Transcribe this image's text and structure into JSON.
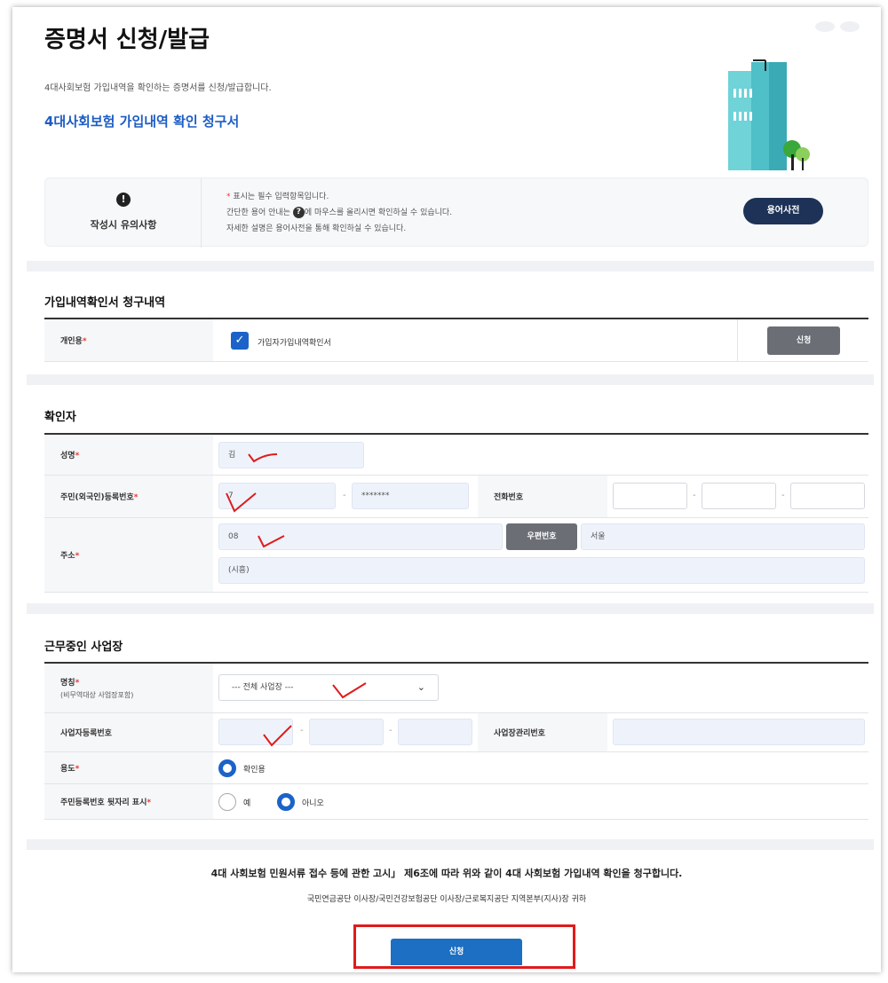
{
  "header": {
    "title": "증명서 신청/발급",
    "description": "4대사회보험 가입내역을 확인하는 증명서를 신청/발급합니다.",
    "doc_title": "4대사회보험 가입내역 확인 청구서"
  },
  "notice": {
    "title": "작성시 유의사항",
    "alert_glyph": "!",
    "line1_star": "*",
    "line1": "표시는 필수 입력항목입니다.",
    "line2_before": "간단한 용어 안내는",
    "line2_icon": "?",
    "line2_after": "에 마우스를 올리시면 확인하실 수 있습니다.",
    "line3": "자세한 설명은 용어사전을 통해 확인하실 수 있습니다.",
    "dict_button": "용어사전"
  },
  "request_section": {
    "title": "가입내역확인서 청구내역",
    "personal_label": "개인용",
    "required_mark": "*",
    "checkbox_glyph": "✓",
    "checkbox_label": "가입자가입내역확인서",
    "apply_button": "신청"
  },
  "verifier_section": {
    "title": "확인자",
    "name_label": "성명",
    "name_value": "김",
    "rrn_label": "주민(외국인)등록번호",
    "rrn_front": "7",
    "rrn_back": "*******",
    "rrn_sep": "-",
    "phone_label": "전화번호",
    "phone_sep": "-",
    "address_label": "주소",
    "zip_value": "08",
    "zip_button": "우편번호",
    "addr1_value": "서울",
    "addr2_value": "(시흥)",
    "required_mark": "*"
  },
  "workplace_section": {
    "title": "근무중인 사업장",
    "name_label": "명칭",
    "name_sub": "(비무역대상 사업장포함)",
    "select_value": "--- 전체 사업장 ---",
    "select_chevron": "⌄",
    "biz_no_label": "사업자등록번호",
    "biz_sep": "-",
    "mgmt_no_label": "사업장관리번호",
    "purpose_label": "용도",
    "purpose_option": "확인용",
    "rrn_display_label": "주민등록번호 뒷자리 표시",
    "rrn_display_yes": "예",
    "rrn_display_no": "아니오",
    "required_mark": "*"
  },
  "footer": {
    "claim_text": "4대 사회보험 민원서류 접수 등에 관한 고시」 제6조에 따라 위와 같이 4대 사회보험 가입내역 확인을 청구합니다.",
    "recipients": "국민연금공단 이사장/국민건강보험공단 이사장/근로복지공단 지역본부(지사)장 귀하",
    "submit_button": "신청"
  },
  "colors": {
    "accent_blue": "#1c5cc4",
    "checkbox_blue": "#1b63c8",
    "dict_button_navy": "#1d3256",
    "gray_button": "#6b6f75",
    "highlight_red": "#e01b1b",
    "required_red": "#e33333"
  },
  "icons": {
    "alert": "alert-circle-icon",
    "help": "question-circle-icon",
    "building": "building-illustration",
    "dropdown": "chevron-down-icon"
  }
}
